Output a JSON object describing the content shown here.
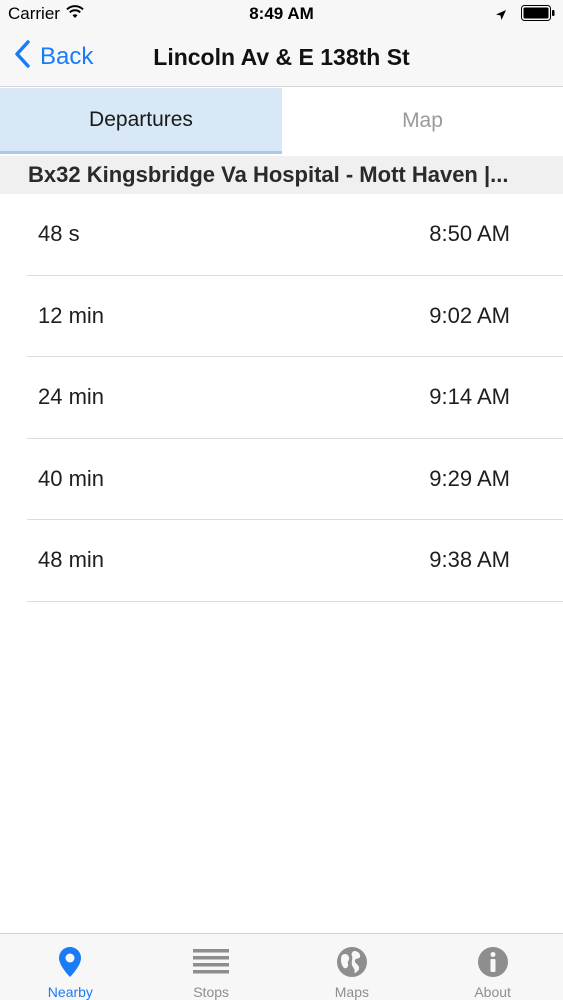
{
  "status_bar": {
    "carrier": "Carrier",
    "time": "8:49 AM"
  },
  "nav": {
    "back_label": "Back",
    "title": "Lincoln Av & E 138th St"
  },
  "segments": {
    "departures": "Departures",
    "map": "Map"
  },
  "route": {
    "header": "Bx32 Kingsbridge Va Hospital - Mott Haven |..."
  },
  "departures": [
    {
      "eta": "48 s",
      "time": "8:50 AM"
    },
    {
      "eta": "12 min",
      "time": "9:02 AM"
    },
    {
      "eta": "24 min",
      "time": "9:14 AM"
    },
    {
      "eta": "40 min",
      "time": "9:29 AM"
    },
    {
      "eta": "48 min",
      "time": "9:38 AM"
    }
  ],
  "tab_bar": {
    "items": [
      {
        "label": "Nearby",
        "icon": "location-pin-icon",
        "active": true
      },
      {
        "label": "Stops",
        "icon": "list-icon",
        "active": false
      },
      {
        "label": "Maps",
        "icon": "globe-icon",
        "active": false
      },
      {
        "label": "About",
        "icon": "info-icon",
        "active": false
      }
    ]
  },
  "colors": {
    "accent": "#1a7cf5",
    "segment_active_bg": "#d8e8f7",
    "inactive": "#8e8e8e"
  }
}
